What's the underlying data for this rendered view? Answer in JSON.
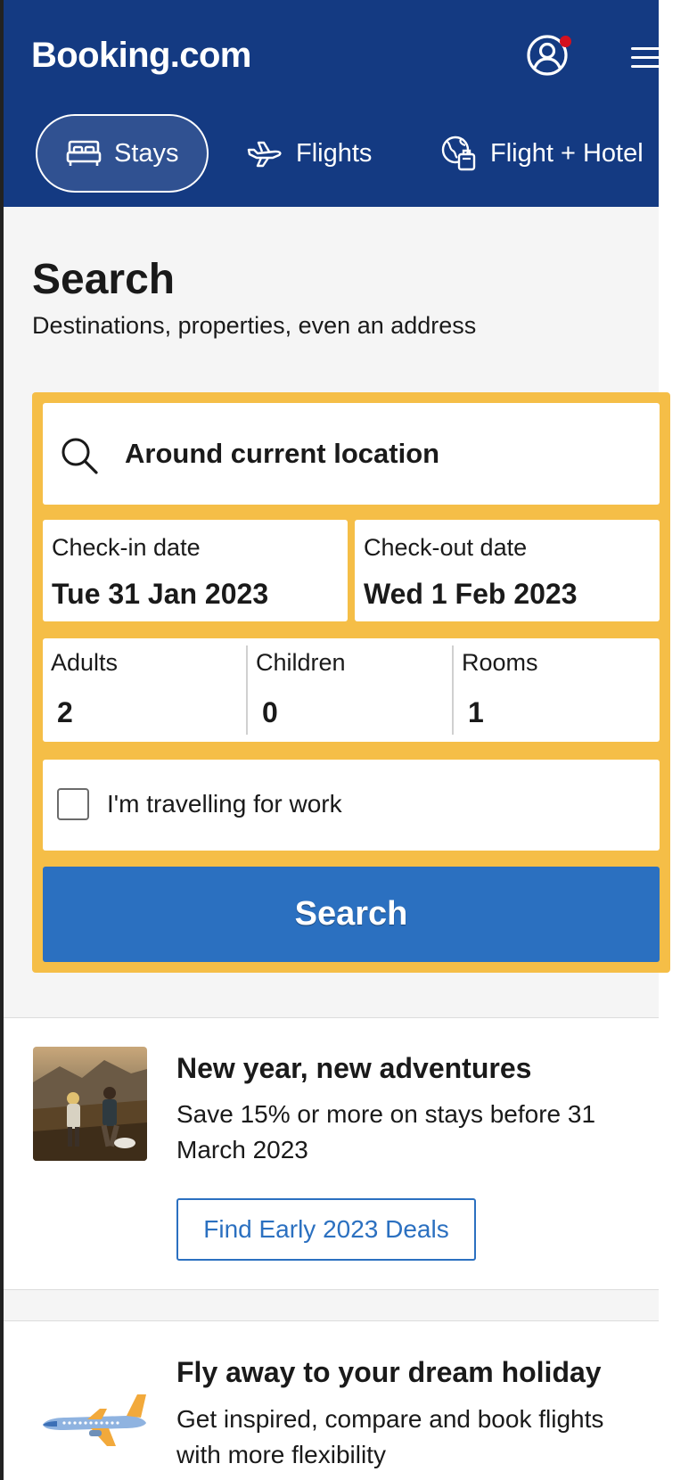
{
  "header": {
    "logo": "Booking.com",
    "colors": {
      "primary": "#143a82",
      "notification": "#d4111e"
    },
    "icons": {
      "account": "user-circle-icon",
      "menu": "hamburger-menu-icon"
    }
  },
  "nav": {
    "tabs": [
      {
        "label": "Stays",
        "icon": "bed-icon",
        "active": true
      },
      {
        "label": "Flights",
        "icon": "plane-icon",
        "active": false
      },
      {
        "label": "Flight + Hotel",
        "icon": "globe-luggage-icon",
        "active": false
      }
    ]
  },
  "search": {
    "title": "Search",
    "subtitle": "Destinations, properties, even an address",
    "destination": {
      "value": "Around current location",
      "icon": "search-icon"
    },
    "checkin": {
      "label": "Check-in date",
      "value": "Tue 31 Jan 2023"
    },
    "checkout": {
      "label": "Check-out date",
      "value": "Wed 1 Feb 2023"
    },
    "occupancy": {
      "adults": {
        "label": "Adults",
        "value": "2"
      },
      "children": {
        "label": "Children",
        "value": "0"
      },
      "rooms": {
        "label": "Rooms",
        "value": "1"
      }
    },
    "work_travel": {
      "label": "I'm travelling for work",
      "checked": false
    },
    "button_label": "Search",
    "colors": {
      "form_border": "#f5be47",
      "button": "#2b70c0"
    }
  },
  "promos": [
    {
      "title": "New year, new adventures",
      "text": "Save 15% or more on stays before 31 March 2023",
      "button_label": "Find Early 2023 Deals"
    },
    {
      "title": "Fly away to your dream holiday",
      "text": "Get inspired, compare and book flights with more flexibility"
    }
  ]
}
